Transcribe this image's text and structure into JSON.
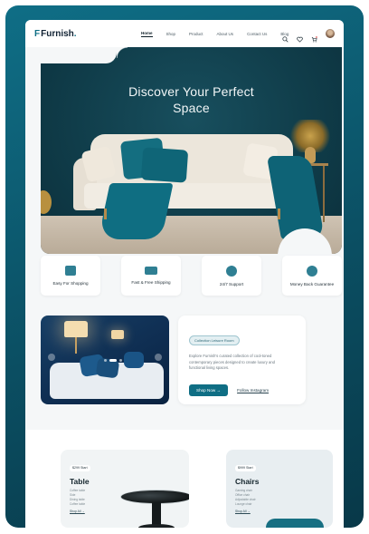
{
  "nav": {
    "logo_mark": "F",
    "logo_text": "Furnish",
    "logo_dot": ".",
    "links": [
      "Home",
      "Shop",
      "Product",
      "About Us",
      "Contact Us",
      "Blog"
    ],
    "active_index": 0,
    "icons": [
      "search-icon",
      "heart-icon",
      "cart-icon",
      "avatar"
    ]
  },
  "hero": {
    "title_line1": "Discover Your Perfect",
    "title_line2": "Space"
  },
  "features": [
    {
      "label": "Easy For Shopping",
      "icon": "shopping-bag-icon"
    },
    {
      "label": "Fast & Free Shipping",
      "icon": "truck-icon"
    },
    {
      "label": "24/7 Support",
      "icon": "support-icon"
    },
    {
      "label": "Money Back Guarantee",
      "icon": "money-back-icon"
    }
  ],
  "showcase": {
    "badge": "Collection Leisure Room",
    "text": "Explore Furnish's curated collection of cool-toned contemporary pieces designed to create luxury and functional living spaces.",
    "cta": "Shop Now →",
    "link": "Follow Instagram"
  },
  "products": [
    {
      "price": "$299 Start",
      "title": "Table",
      "items": [
        "Coffee table",
        "Side",
        "Dining table",
        "Coffee table"
      ],
      "link": "Shop All →"
    },
    {
      "price": "$999 Start",
      "title": "Chairs",
      "items": [
        "Gaming chair",
        "Office chair",
        "Adjustable chair",
        "Lounge chair"
      ],
      "link": "Shop All →"
    }
  ],
  "colors": {
    "accent": "#0f6e84",
    "frame": "#0b4f63",
    "page_bg": "#f5f7f8"
  }
}
